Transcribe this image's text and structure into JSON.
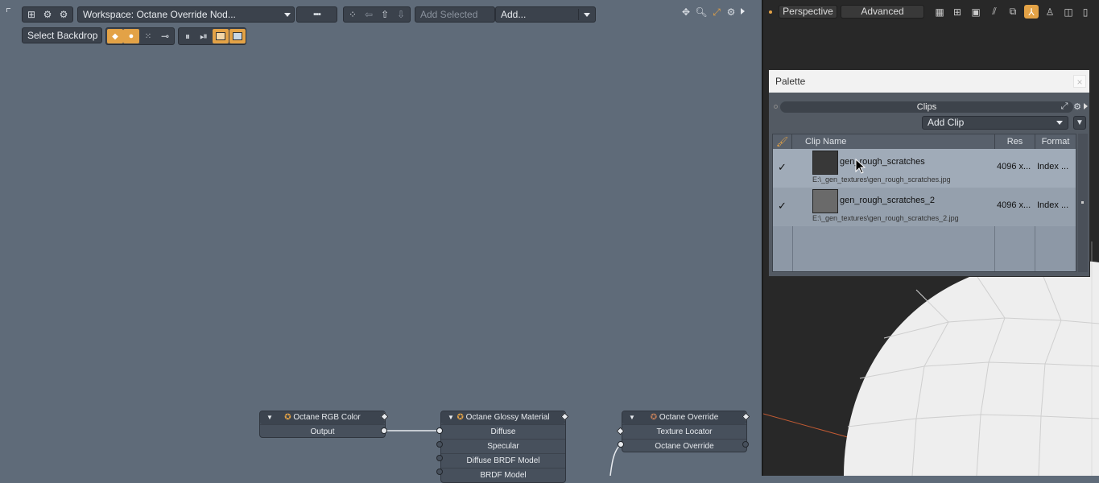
{
  "graph_toolbar": {
    "workspace_label": "Workspace: Octane Override Nod...",
    "add_selected_placeholder": "Add Selected",
    "add_label": "Add...",
    "select_backdrop_label": "Select Backdrop"
  },
  "right_toolbar_icons": [
    "move-icon",
    "zoom-icon",
    "expand-icon",
    "gear-icon",
    "arrow-right-icon"
  ],
  "nodes": {
    "rgb": {
      "title": "Octane RGB Color",
      "ports": [
        "Output"
      ]
    },
    "glossy": {
      "title": "Octane Glossy Material",
      "ports": [
        "Diffuse",
        "Specular",
        "Diffuse BRDF Model",
        "BRDF Model"
      ]
    },
    "override": {
      "title": "Octane Override",
      "ports": [
        "Texture Locator",
        "Octane Override"
      ]
    }
  },
  "viewport": {
    "view_label": "Perspective",
    "mode_label": "Advanced",
    "toolbar_icons": [
      "grid-icon",
      "wireframe-icon",
      "shaded-icon",
      "texture-icon",
      "frame-icon",
      "active-light-icon",
      "person-icon",
      "split-icon",
      "overflow-icon"
    ]
  },
  "palette": {
    "title": "Palette",
    "close_icon": "×",
    "section": "Clips",
    "add_clip_label": "Add Clip",
    "columns": {
      "brush": "",
      "name": "Clip Name",
      "res": "Res",
      "format": "Format"
    },
    "clips": [
      {
        "check": "✓",
        "name": "gen_rough_scratches",
        "path": "E:\\_gen_textures\\gen_rough_scratches.jpg",
        "res": "4096 x...",
        "format": "Index ..."
      },
      {
        "check": "✓",
        "name": "gen_rough_scratches_2",
        "path": "E:\\_gen_textures\\gen_rough_scratches_2.jpg",
        "res": "4096 x...",
        "format": "Index ..."
      }
    ]
  },
  "colors": {
    "graph_bg": "#5f6b79",
    "accent": "#e3a246",
    "viewport_bg": "#282828"
  }
}
